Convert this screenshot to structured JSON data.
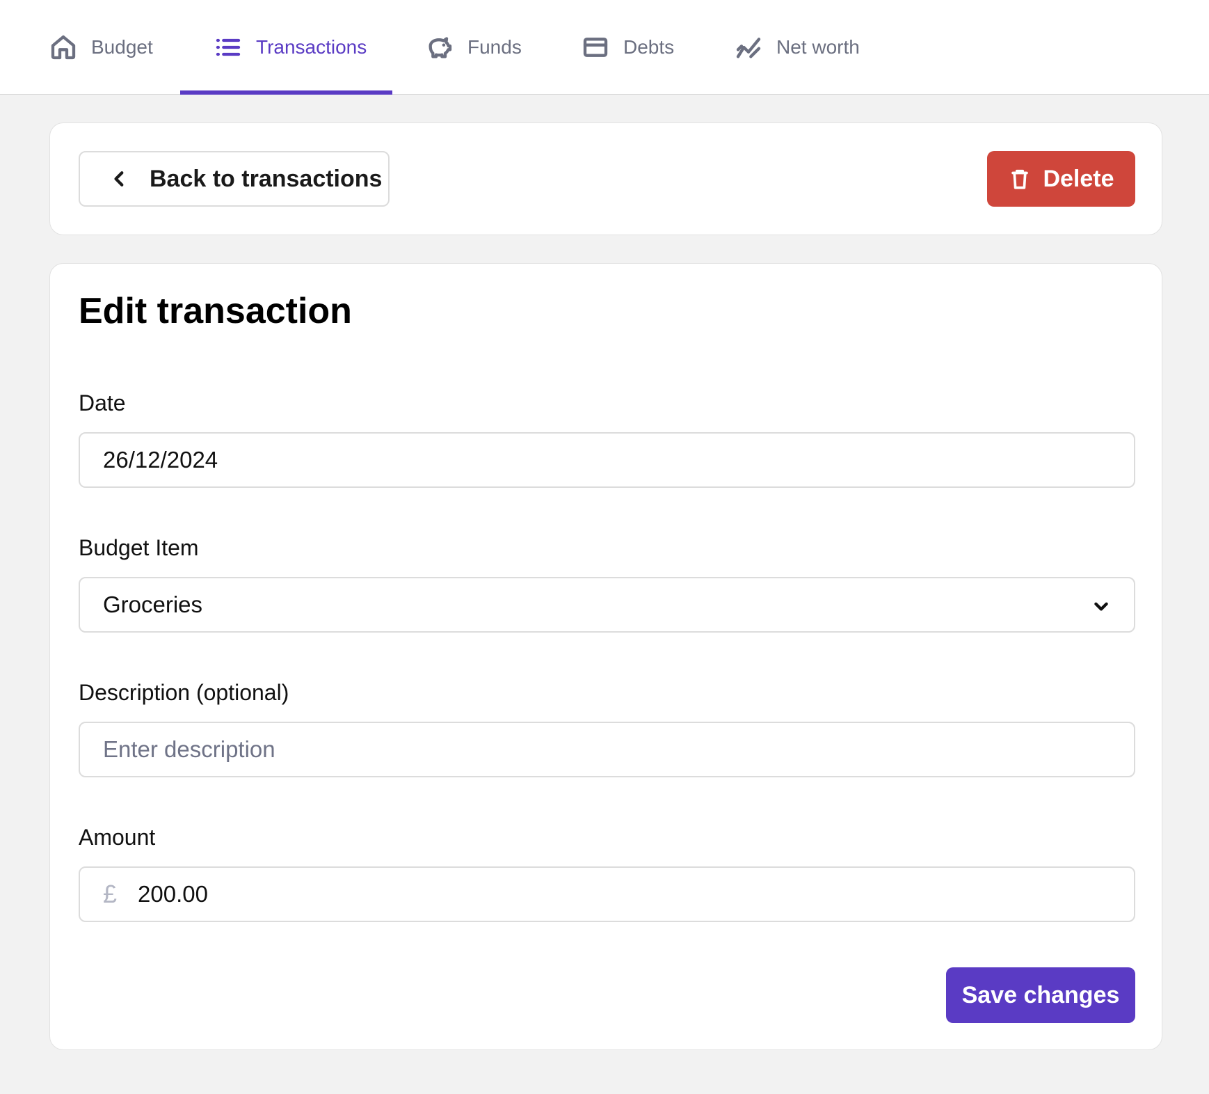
{
  "nav": {
    "tabs": [
      {
        "label": "Budget",
        "icon": "home-icon"
      },
      {
        "label": "Transactions",
        "icon": "list-icon"
      },
      {
        "label": "Funds",
        "icon": "piggy-bank-icon"
      },
      {
        "label": "Debts",
        "icon": "credit-card-icon"
      },
      {
        "label": "Net worth",
        "icon": "trend-chart-icon"
      }
    ],
    "active_tab": "Transactions"
  },
  "toolbar": {
    "back_label": "Back to transactions",
    "delete_label": "Delete"
  },
  "form": {
    "title": "Edit transaction",
    "date": {
      "label": "Date",
      "value": "26/12/2024"
    },
    "budget_item": {
      "label": "Budget Item",
      "value": "Groceries"
    },
    "description": {
      "label": "Description (optional)",
      "value": "",
      "placeholder": "Enter description"
    },
    "amount": {
      "label": "Amount",
      "currency": "£",
      "value": "200.00"
    },
    "save_label": "Save changes"
  },
  "colors": {
    "accent": "#5a3bc4",
    "danger": "#cf463b",
    "background": "#f2f2f2",
    "muted_text": "#6b6f80"
  }
}
